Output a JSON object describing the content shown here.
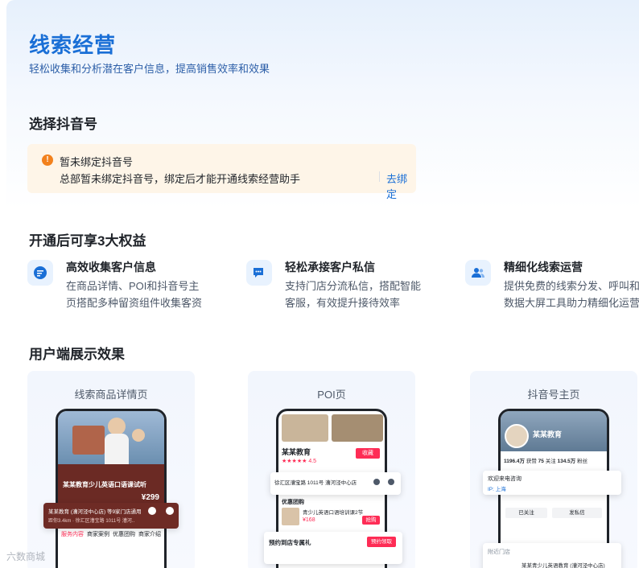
{
  "header": {
    "title": "线索经营",
    "subtitle": "轻松收集和分析潜在客户信息，提高销售效率和效果"
  },
  "select_account": {
    "section_title": "选择抖音号",
    "alert": {
      "icon": "warning-icon",
      "title": "暂未绑定抖音号",
      "description": "总部暂未绑定抖音号，绑定后才能开通线索经营助手",
      "link_label": "去绑定"
    }
  },
  "benefits": {
    "section_title": "开通后可享3大权益",
    "items": [
      {
        "icon": "document-icon",
        "title": "高效收集客户信息",
        "desc_line1": "在商品详情、POI和抖音号主",
        "desc_line2": "页搭配多种留资组件收集客资"
      },
      {
        "icon": "chat-icon",
        "title": "轻松承接客户私信",
        "desc_line1": "支持门店分流私信，搭配智能",
        "desc_line2": "客服，有效提升接待效率"
      },
      {
        "icon": "users-icon",
        "title": "精细化线索运营",
        "desc_line1": "提供免费的线索分发、呼叫和",
        "desc_line2": "数据大屏工具助力精细化运营"
      }
    ]
  },
  "display": {
    "section_title": "用户端展示效果",
    "cards": [
      {
        "title": "线索商品详情页",
        "product_title": "某某教育少儿英语口语课试听",
        "price": "299",
        "store_name": "某某教育 (漕河泾中心店) 等9家门店通用",
        "store_addr": "距你3.4km · 徐汇区漕宝路 1011号 漕河..",
        "nav_label": "导航",
        "phone_label": "电话",
        "tabs": [
          "服务内容",
          "商家案例",
          "优惠团购",
          "商家介绍"
        ]
      },
      {
        "title": "POI页",
        "shop_name": "某某教育",
        "rating": "4.5",
        "follow_label": "收藏",
        "addr": "徐汇区漕宝路 1011号 漕河泾中心店",
        "group_label": "优惠团购",
        "group_item": "青少儿英语口语培训课2节",
        "group_price": "168",
        "buy_label": "抢购",
        "reserve_title": "预约到店专属礼",
        "reserve_btn": "预约领取"
      },
      {
        "title": "抖音号主页",
        "account_name": "某某教育",
        "fans": "1196.4万",
        "following": "75",
        "likes": "134.5万",
        "welcome": "欢迎来电咨询",
        "location": "上海",
        "followed_label": "已关注",
        "message_label": "发私信",
        "nearby_label": "附近门店",
        "store_item": "某某青少儿英语教育 (漕河泾中心店)"
      }
    ]
  },
  "watermark": "六数商城",
  "colors": {
    "accent": "#1a6fd6",
    "alert_bg": "#fef5e8",
    "warning": "#f2811d",
    "brand_red": "#fe2c55"
  }
}
